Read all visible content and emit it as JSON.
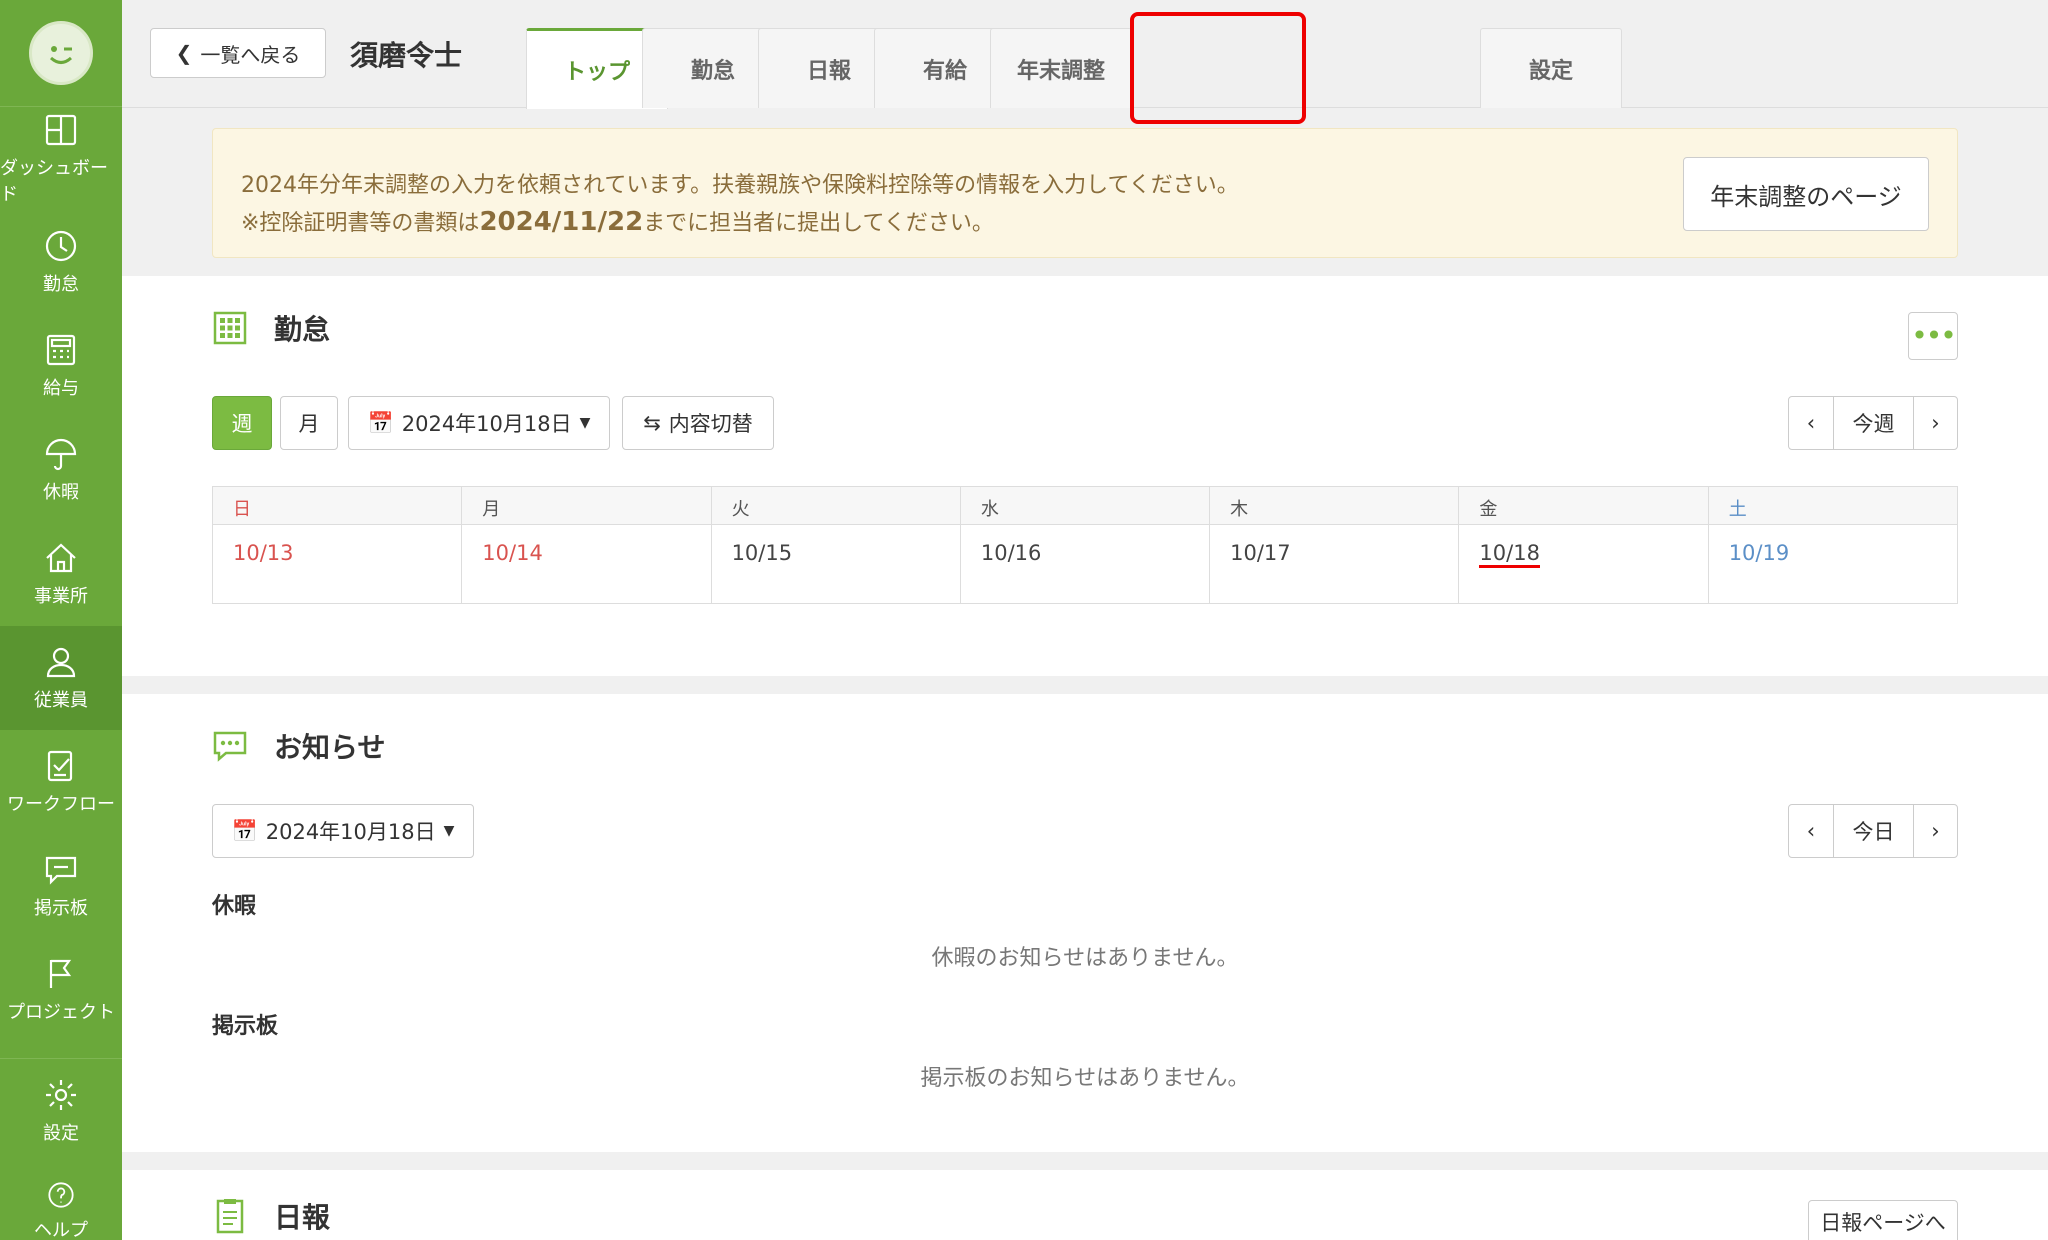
{
  "sidebar": {
    "items": [
      {
        "label": "ダッシュボード",
        "icon": "dashboard-icon"
      },
      {
        "label": "勤怠",
        "icon": "clock-icon"
      },
      {
        "label": "給与",
        "icon": "calculator-icon"
      },
      {
        "label": "休暇",
        "icon": "umbrella-icon"
      },
      {
        "label": "事業所",
        "icon": "home-icon"
      },
      {
        "label": "従業員",
        "icon": "person-icon"
      },
      {
        "label": "ワークフロー",
        "icon": "checklist-icon"
      },
      {
        "label": "掲示板",
        "icon": "chat-icon"
      },
      {
        "label": "プロジェクト",
        "icon": "flag-icon"
      }
    ],
    "bottom": [
      {
        "label": "設定",
        "icon": "gear-icon"
      },
      {
        "label": "ヘルプ",
        "icon": "help-icon"
      }
    ],
    "active_index": 5,
    "color": "#6aa83a"
  },
  "header": {
    "back_label": "一覧へ戻る",
    "employee_name": "須磨令士",
    "tabs": [
      "トップ",
      "勤怠",
      "日報",
      "有給",
      "年末調整"
    ],
    "settings_tab": "設定",
    "active_tab": "トップ",
    "highlighted_tab": "年末調整"
  },
  "notice": {
    "line1": "2024年分年末調整の入力を依頼されています。扶養親族や保険料控除等の情報を入力してください。",
    "line2_prefix": "※控除証明書等の書類は",
    "line2_date": "2024/11/22",
    "line2_suffix": "までに担当者に提出してください。",
    "button": "年末調整のページ"
  },
  "attendance": {
    "title": "勤怠",
    "week_label": "週",
    "month_label": "月",
    "date_label": "2024年10月18日",
    "switch_label": "内容切替",
    "this_week_label": "今週",
    "days": [
      "日",
      "月",
      "火",
      "水",
      "木",
      "金",
      "土"
    ],
    "dates": [
      "10/13",
      "10/14",
      "10/15",
      "10/16",
      "10/17",
      "10/18",
      "10/19"
    ]
  },
  "news": {
    "title": "お知らせ",
    "date_label": "2024年10月18日",
    "today_label": "今日",
    "leave_heading": "休暇",
    "leave_empty": "休暇のお知らせはありません。",
    "board_heading": "掲示板",
    "board_empty": "掲示板のお知らせはありません。"
  },
  "daily_report": {
    "title": "日報",
    "page_button": "日報ページへ"
  }
}
